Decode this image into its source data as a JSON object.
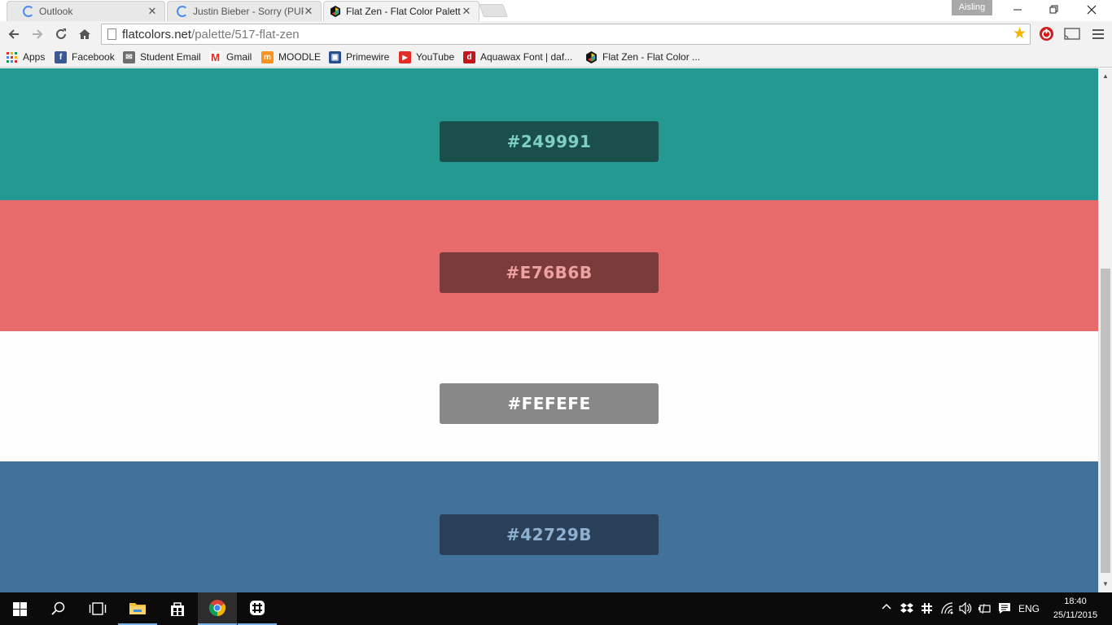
{
  "browser": {
    "tabs": [
      {
        "title": "Outlook",
        "close": "✕",
        "favicon": "loading-spinner-icon"
      },
      {
        "title": "Justin Bieber - Sorry (PURI",
        "close": "✕",
        "favicon": "loading-spinner-icon"
      },
      {
        "title": "Flat Zen - Flat Color Palett",
        "close": "✕",
        "favicon": "flatcolors-hexagon-icon"
      }
    ],
    "profile_name": "Aisling",
    "address": {
      "domain": "flatcolors.net",
      "path": "/palette/517-flat-zen"
    },
    "bookmarks": [
      {
        "label": "Apps",
        "icon": "apps-grid-icon"
      },
      {
        "label": "Facebook",
        "icon": "facebook-icon"
      },
      {
        "label": "Student Email",
        "icon": "student-email-icon"
      },
      {
        "label": "Gmail",
        "icon": "gmail-icon"
      },
      {
        "label": "MOODLE",
        "icon": "moodle-icon"
      },
      {
        "label": "Primewire",
        "icon": "primewire-icon"
      },
      {
        "label": "YouTube",
        "icon": "youtube-icon"
      },
      {
        "label": "Aquawax Font | daf...",
        "icon": "dafont-icon"
      },
      {
        "label": "Flat Zen - Flat Color ...",
        "icon": "flatcolors-hexagon-icon"
      }
    ]
  },
  "palette": [
    {
      "hex": "#249991",
      "bg": "#249991",
      "box": "#1b4f4b",
      "text": "#7fcfc6"
    },
    {
      "hex": "#E76B6B",
      "bg": "#E76B6B",
      "box": "#7b3b3b",
      "text": "#eea1a1"
    },
    {
      "hex": "#FEFEFE",
      "bg": "#FEFEFE",
      "box": "#888888",
      "text": "#ffffff"
    },
    {
      "hex": "#42729B",
      "bg": "#42729B",
      "box": "#2a3f58",
      "text": "#8db0d0"
    }
  ],
  "taskbar": {
    "language": "ENG",
    "time": "18:40",
    "date": "25/11/2015"
  }
}
